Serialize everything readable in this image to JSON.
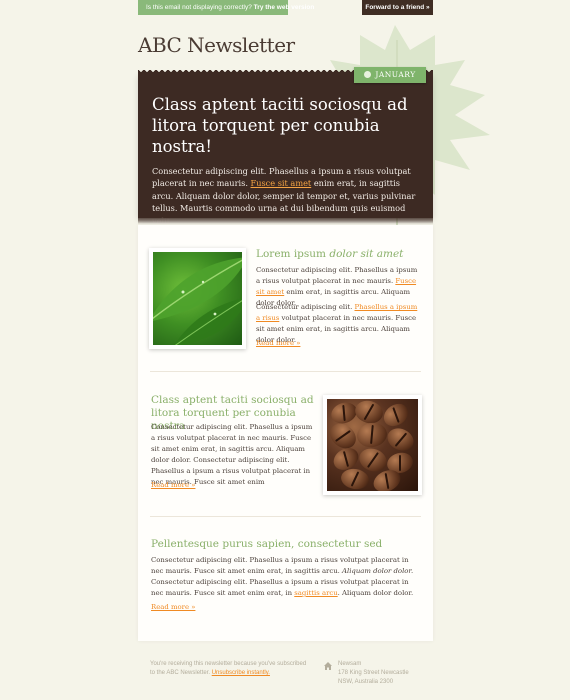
{
  "topbar": {
    "left_text": "Is this email not displaying correctly?",
    "left_link": "Try the web version",
    "right_link": "Forward to a friend »"
  },
  "logo": "ABC Newsletter",
  "hero": {
    "badge": "JANUARY",
    "headline": "Class aptent taciti sociosqu ad litora torquent per conubia nostra!",
    "body_1": "Consectetur adipiscing elit. Phasellus a ipsum a risus volutpat placerat in nec mauris. ",
    "body_link": "Fusce sit amet",
    "body_2": " enim erat, in sagittis arcu. Aliquam dolor dolor, semper id tempor et, varius pulvinar tellus. Maurtis commodo urna at dui bibendum quis euismod velit"
  },
  "article1": {
    "title_plain": "Lorem ipsum ",
    "title_italic": "dolor sit amet",
    "p1_a": "Consectetur adipiscing elit. Phasellus a ipsum a risus volutpat placerat in nec mauris. ",
    "p1_link": "Fusce sit amet",
    "p1_b": " enim erat, in sagittis arcu. Aliquam dolor dolor.",
    "p2_a": "Consectetur adipiscing elit. ",
    "p2_link": "Phasellus a ipsum a risus",
    "p2_b": " volutpat placerat in nec mauris. Fusce sit amet enim erat, in sagittis arcu. Aliquam dolor dolor.",
    "read_more": "Read more »"
  },
  "article2": {
    "title": "Class aptent taciti sociosqu ad litora torquent per conubia nostra",
    "p1": "Consectetur adipiscing elit. Phasellus a ipsum a risus volutpat placerat in nec mauris. Fusce sit amet enim erat, in sagittis arcu. Aliquam dolor dolor. Consectetur adipiscing elit. Phasellus a ipsum a risus volutpat placerat in nec mauris. Fusce sit amet enim",
    "read_more": "Read more »"
  },
  "article3": {
    "title": "Pellentesque purus sapien, consectetur sed",
    "p1_a": "Consectetur adipiscing elit. Phasellus a ipsum a risus volutpat placerat in nec mauris. Fusce sit amet enim erat, in sagittis arcu. ",
    "p1_italic": "Aliquam dolor dolor.",
    "p1_b": " Consectetur adipiscing elit. Phasellus a ipsum a risus volutpat placerat in nec mauris. Fusce sit amet enim erat, in ",
    "p1_link": "sagittis arcu",
    "p1_c": ". Aliquam dolor dolor.",
    "read_more": "Read more »"
  },
  "footer": {
    "text_1": "You're receiving this newsletter because you've subscribed to the ABC Newsletter. ",
    "unsubscribe": "Unsubscribe instantly.",
    "address_1": "Newsam",
    "address_2": "178 King Street Newcastle",
    "address_3": "NSW, Australia 2300"
  },
  "colors": {
    "background": "#f5f4e9",
    "brown": "#3d2a23",
    "green": "#8ab06a",
    "orange": "#f08a23"
  },
  "icons": [
    "home-icon",
    "calendar-dot-icon"
  ]
}
